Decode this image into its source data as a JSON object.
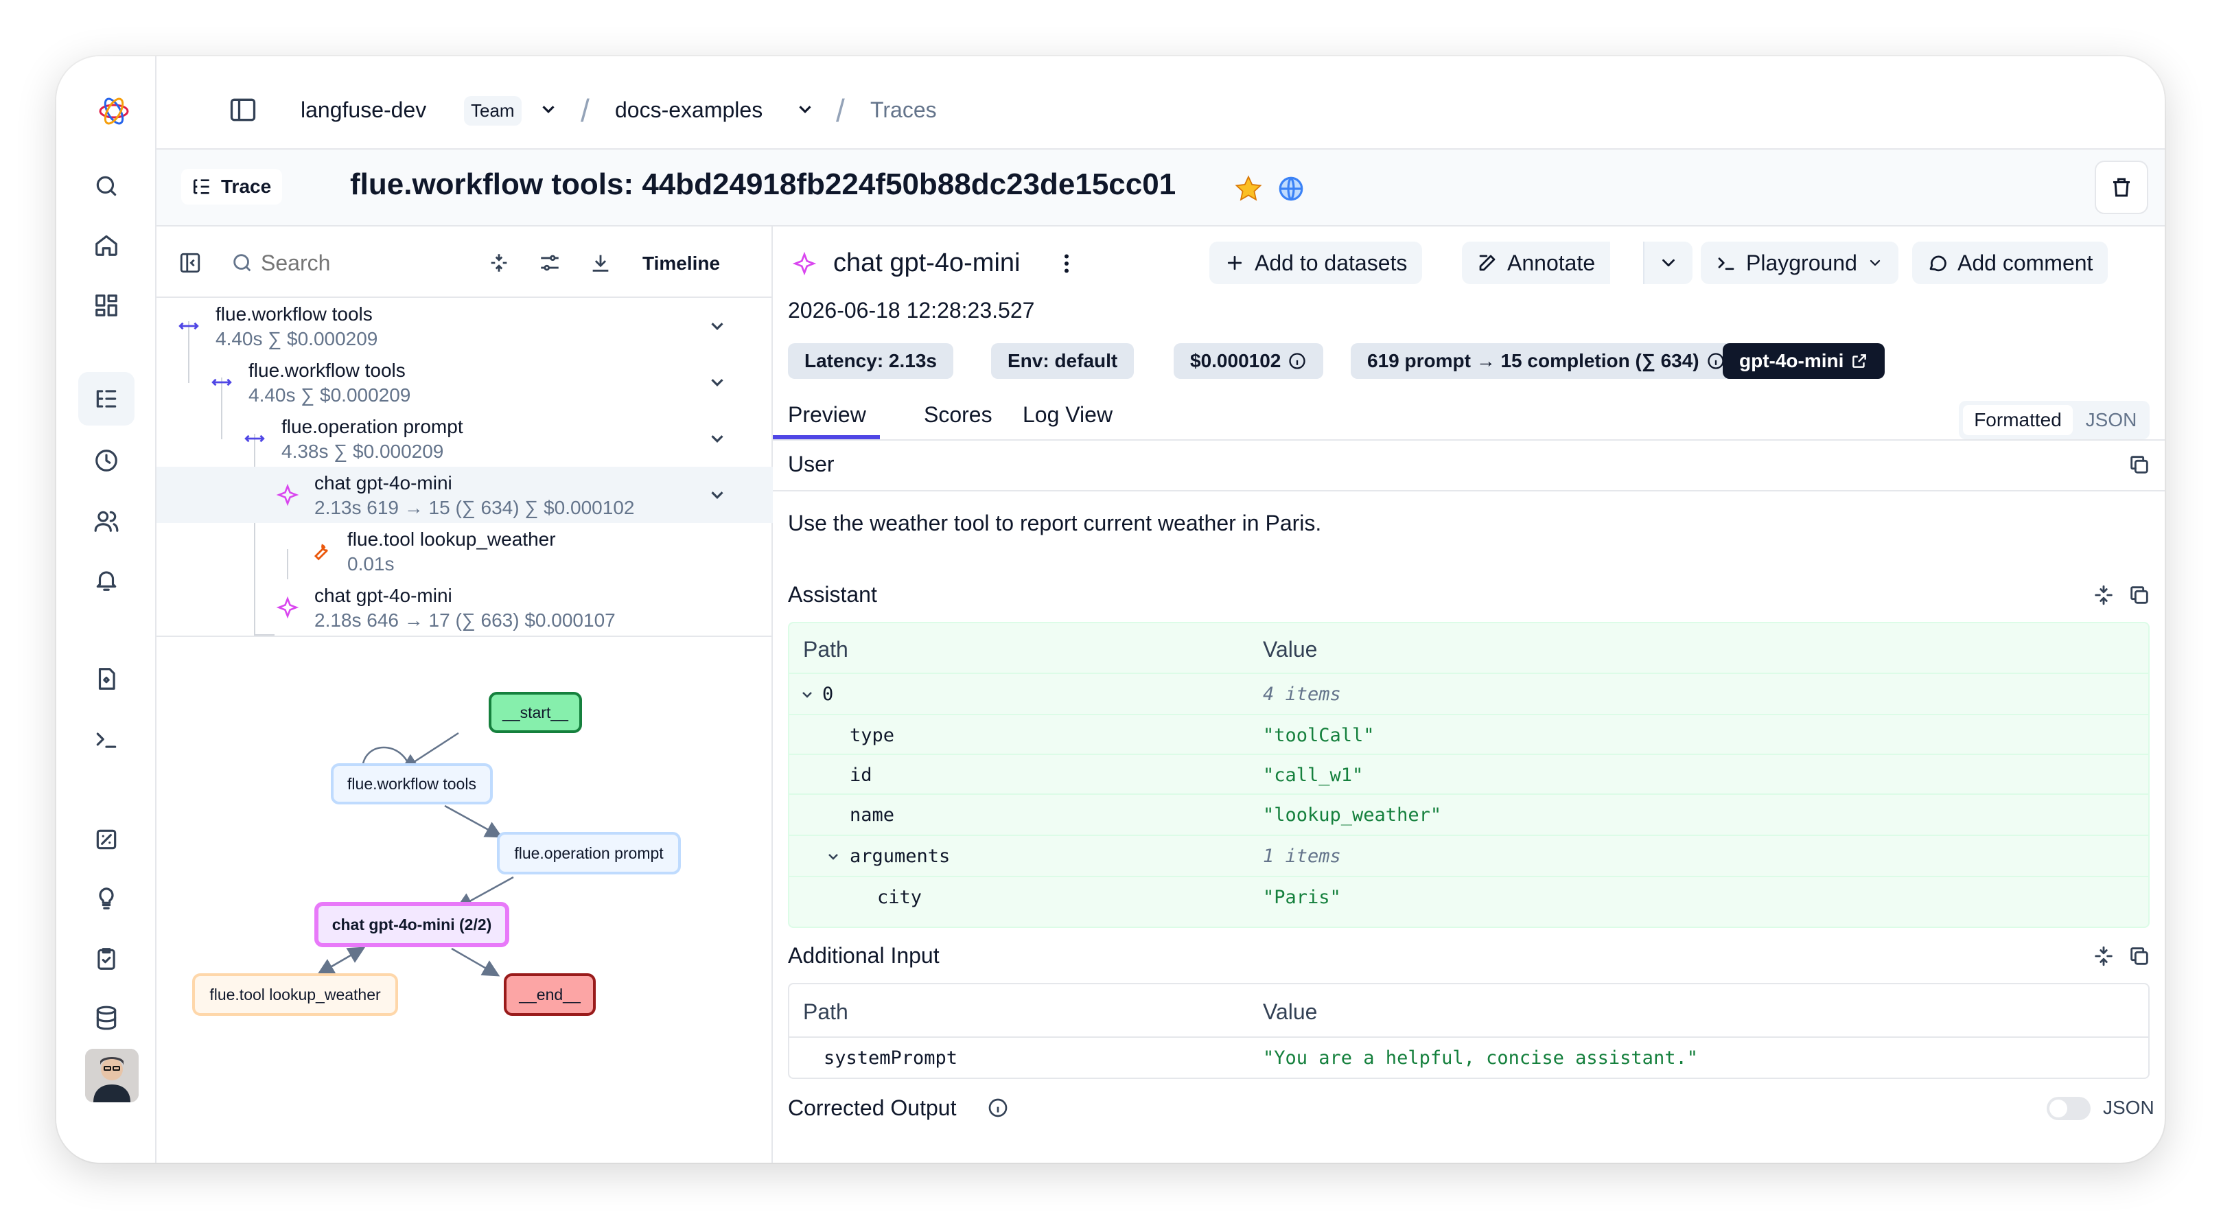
{
  "breadcrumb": {
    "org": "langfuse-dev",
    "team_badge": "Team",
    "project": "docs-examples",
    "page": "Traces"
  },
  "trace": {
    "pill_label": "Trace",
    "title": "flue.workflow tools: 44bd24918fb224f50b88dc23de15cc01"
  },
  "tree_toolbar": {
    "search_placeholder": "Search",
    "timeline_label": "Timeline"
  },
  "tree": [
    {
      "name": "flue.workflow tools",
      "meta": "4.40s  ∑ $0.000209"
    },
    {
      "name": "flue.workflow tools",
      "meta": "4.40s  ∑ $0.000209"
    },
    {
      "name": "flue.operation prompt",
      "meta": "4.38s  ∑ $0.000209"
    },
    {
      "name": "chat gpt-4o-mini",
      "meta": "2.13s   619 → 15 (∑ 634)   ∑ $0.000102"
    },
    {
      "name": "flue.tool lookup_weather",
      "meta": "0.01s"
    },
    {
      "name": "chat gpt-4o-mini",
      "meta": "2.18s   646 → 17 (∑ 663)   $0.000107"
    }
  ],
  "graph": {
    "start": "__start__",
    "workflow": "flue.workflow tools",
    "operation": "flue.operation prompt",
    "chat": "chat gpt-4o-mini (2/2)",
    "tool": "flue.tool lookup_weather",
    "end": "__end__"
  },
  "observation": {
    "title": "chat gpt-4o-mini",
    "timestamp": "2026-06-18 12:28:23.527",
    "actions": {
      "add_to_datasets": "Add to datasets",
      "annotate": "Annotate",
      "playground": "Playground",
      "add_comment": "Add comment"
    },
    "badges": {
      "latency": "Latency: 2.13s",
      "env": "Env: default",
      "cost": "$0.000102",
      "tokens": "619 prompt → 15 completion (∑ 634)",
      "model": "gpt-4o-mini"
    },
    "tabs": [
      "Preview",
      "Scores",
      "Log View"
    ],
    "view_toggle": [
      "Formatted",
      "JSON"
    ]
  },
  "user_section": {
    "title": "User",
    "message": "Use the weather tool to report current weather in Paris."
  },
  "assistant_section": {
    "title": "Assistant",
    "header": {
      "path": "Path",
      "value": "Value"
    },
    "rows": [
      {
        "path": "0",
        "value": "4 items"
      },
      {
        "path": "type",
        "value": "\"toolCall\""
      },
      {
        "path": "id",
        "value": "\"call_w1\""
      },
      {
        "path": "name",
        "value": "\"lookup_weather\""
      },
      {
        "path": "arguments",
        "value": "1 items"
      },
      {
        "path": "city",
        "value": "\"Paris\""
      }
    ]
  },
  "additional_input": {
    "title": "Additional Input",
    "header": {
      "path": "Path",
      "value": "Value"
    },
    "rows": [
      {
        "path": "systemPrompt",
        "value": "\"You are a helpful, concise assistant.\""
      }
    ]
  },
  "corrected_output": {
    "title": "Corrected Output",
    "toggle_label": "JSON"
  },
  "colors": {
    "accent": "#4f46e5",
    "model_badge": "#0f172a",
    "success_bg": "#f0fdf4",
    "value_green": "#15803d"
  }
}
